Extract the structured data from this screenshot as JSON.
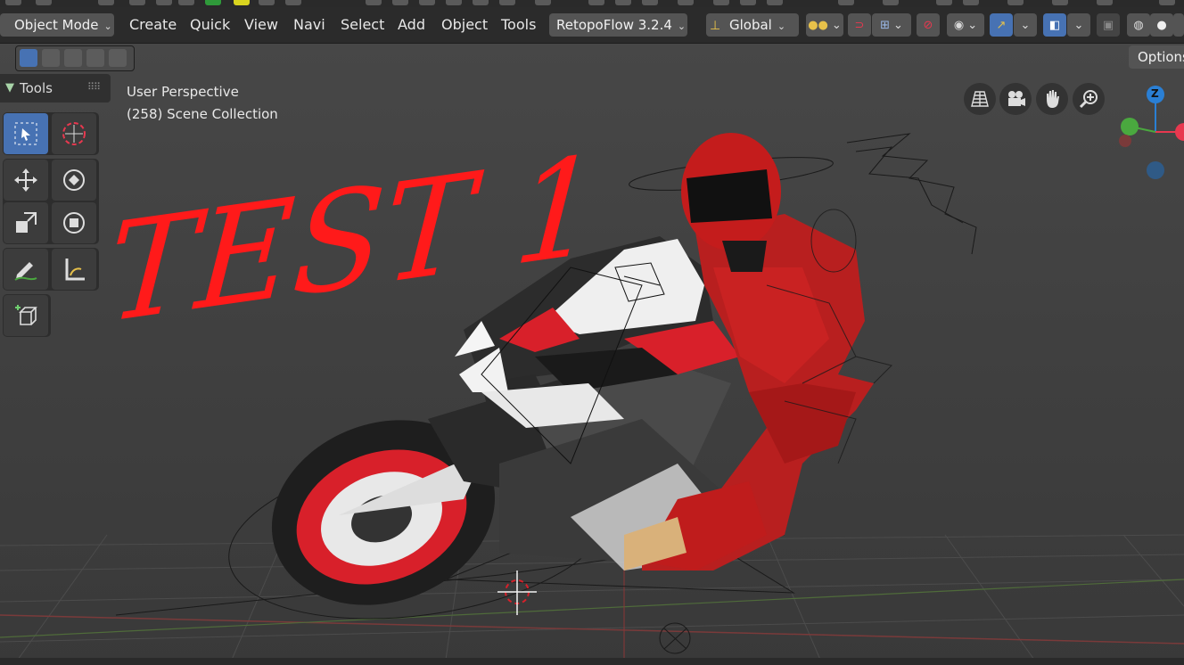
{
  "header": {
    "mode_label": "Object Mode",
    "menus": [
      "Create",
      "Quick",
      "View",
      "Navi",
      "Select",
      "Add",
      "Object",
      "Tools"
    ],
    "retopoflow_label": "RetopoFlow 3.2.4",
    "orientation_label": "Global",
    "options_label": "Options"
  },
  "toolbar": {
    "title": "Tools",
    "tools": [
      "select-box",
      "cursor",
      "move",
      "rotate",
      "scale",
      "transform",
      "annotate",
      "measure",
      "add-cube"
    ]
  },
  "viewport": {
    "perspective_label": "User Perspective",
    "collection_label": "(258) Scene Collection",
    "overlay_text": "TEST 1",
    "overlay_color": "#ff1a1a",
    "gizmo": {
      "z_label": "Z"
    }
  },
  "colors": {
    "accent": "#4772b3",
    "header_bg": "#2b2b2b",
    "viewport_bg": "#404040",
    "red_gizmo": "#e8384f",
    "green_gizmo": "#4aa83f",
    "blue_gizmo": "#2a7fd4"
  }
}
